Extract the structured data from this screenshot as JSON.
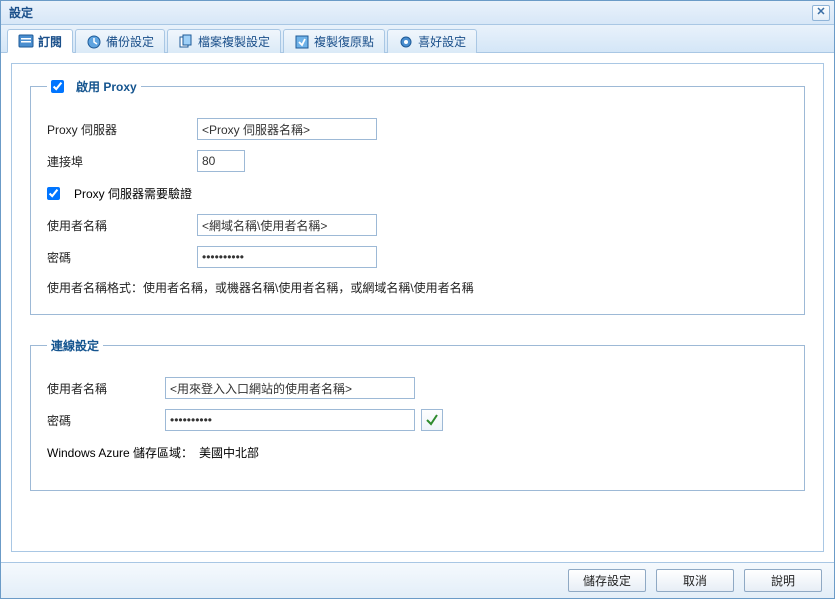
{
  "window": {
    "title": "設定"
  },
  "tabs": [
    {
      "label": "訂閱"
    },
    {
      "label": "備份設定"
    },
    {
      "label": "檔案複製設定"
    },
    {
      "label": "複製復原點"
    },
    {
      "label": "喜好設定"
    }
  ],
  "proxy": {
    "legend": "啟用 Proxy",
    "enable_checked": true,
    "server_label": "Proxy 伺服器",
    "server_value": "<Proxy 伺服器名稱>",
    "port_label": "連接埠",
    "port_value": "80",
    "auth_label": "Proxy 伺服器需要驗證",
    "auth_checked": true,
    "user_label": "使用者名稱",
    "user_value": "<網域名稱\\使用者名稱>",
    "pass_label": "密碼",
    "pass_value": "••••••••••",
    "format_note": "使用者名稱格式：使用者名稱，或機器名稱\\使用者名稱，或網域名稱\\使用者名稱"
  },
  "conn": {
    "legend": "連線設定",
    "user_label": "使用者名稱",
    "user_value": "<用來登入入口網站的使用者名稱>",
    "pass_label": "密碼",
    "pass_value": "••••••••••",
    "region_label": "Windows Azure 儲存區域：",
    "region_value": "美國中北部"
  },
  "buttons": {
    "save": "儲存設定",
    "cancel": "取消",
    "help": "說明"
  }
}
